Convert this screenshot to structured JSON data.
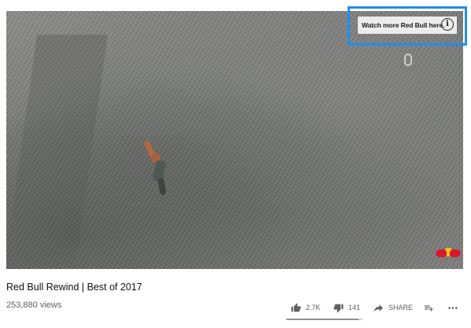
{
  "player": {
    "overlay_card_text": "Watch more Red Bull here.",
    "info_icon": "info-circle-icon",
    "brand_logo": "red-bull-logo"
  },
  "video": {
    "title": "Red Bull Rewind | Best of 2017",
    "views": "253,880 views"
  },
  "actions": {
    "like_count": "2.7K",
    "dislike_count": "141",
    "share_label": "SHARE",
    "add_to_icon": "playlist-add-icon",
    "more_icon": "more-horiz-icon"
  },
  "sentiment": {
    "like_fraction": 0.95
  },
  "colors": {
    "highlight_border": "#1e8df0",
    "card_background": "#ececec",
    "text_secondary": "#606060"
  }
}
